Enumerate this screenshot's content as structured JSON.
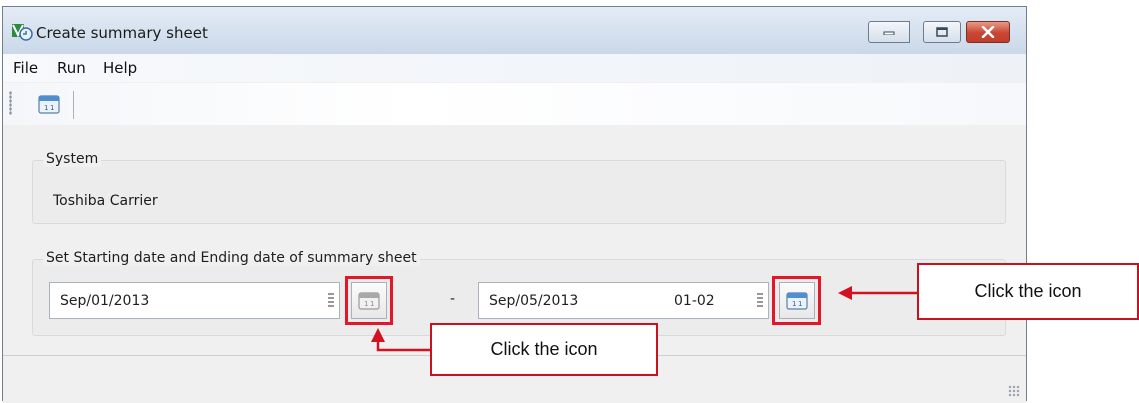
{
  "window": {
    "title": "Create summary sheet",
    "icon": "app-logo-icon"
  },
  "title_controls": {
    "minimize_icon": "minimize-icon",
    "maximize_icon": "maximize-icon",
    "close_icon": "close-icon"
  },
  "menu": {
    "items": [
      {
        "label": "File"
      },
      {
        "label": "Run"
      },
      {
        "label": "Help"
      }
    ]
  },
  "toolbar": {
    "button_icon": "calendar-icon"
  },
  "system_group": {
    "legend": "System",
    "value": "Toshiba Carrier"
  },
  "date_group": {
    "legend": "Set Starting date and Ending date of summary sheet",
    "start_date": "Sep/01/2013",
    "separator": "-",
    "end_date": "Sep/05/2013",
    "end_suffix": "01-02"
  },
  "annotations": {
    "callout_right": "Click the icon",
    "callout_bottom": "Click the icon"
  },
  "colors": {
    "highlight": "#e3162a",
    "callout_border": "#c8121f",
    "close_button": "#c94633"
  }
}
